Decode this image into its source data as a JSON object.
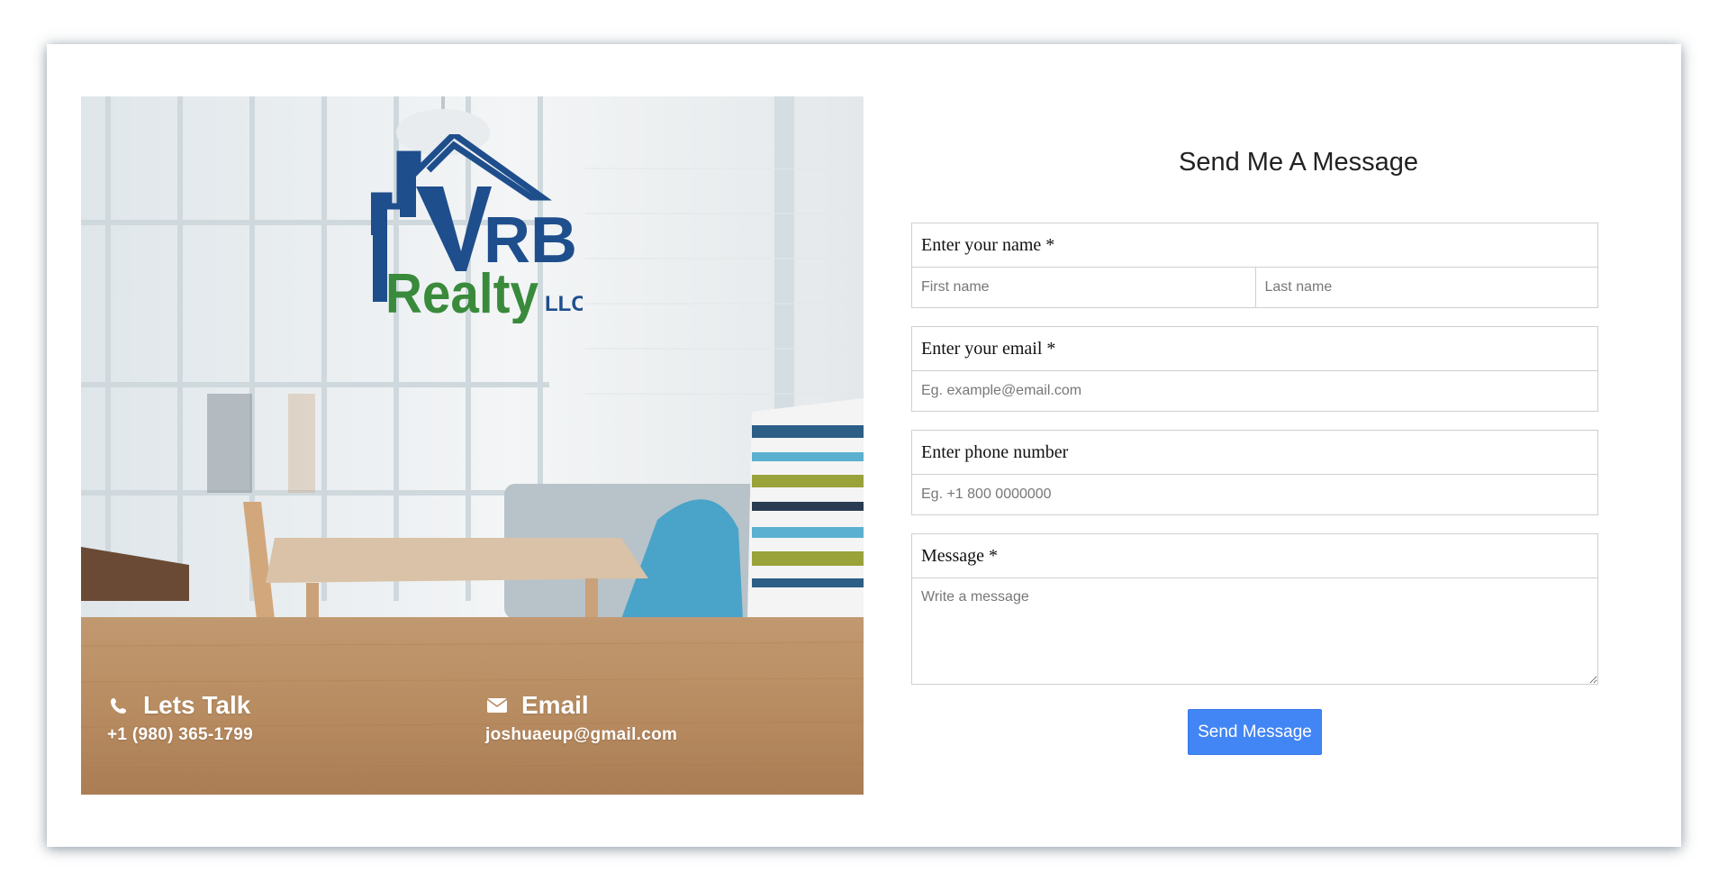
{
  "logo": {
    "text_line1": "RB",
    "text_line2": "Realty",
    "text_suffix": "LLC",
    "colors": {
      "house": "#1f4e8c",
      "realty": "#3a8a3c"
    }
  },
  "contact": {
    "talk": {
      "icon": "phone-icon",
      "title": "Lets Talk",
      "value": "+1 (980) 365-1799"
    },
    "email": {
      "icon": "envelope-icon",
      "title": "Email",
      "value": "joshuaeup@gmail.com"
    }
  },
  "form": {
    "title": "Send Me A Message",
    "name": {
      "label": "Enter your name *",
      "first_placeholder": "First name",
      "last_placeholder": "Last name"
    },
    "email": {
      "label": "Enter your email *",
      "placeholder": "Eg. example@email.com"
    },
    "phone": {
      "label": "Enter phone number",
      "placeholder": "Eg. +1 800 0000000"
    },
    "message": {
      "label": "Message *",
      "placeholder": "Write a message"
    },
    "submit_label": "Send Message"
  },
  "colors": {
    "button": "#4285f4",
    "card_shadow": "#283c50"
  }
}
